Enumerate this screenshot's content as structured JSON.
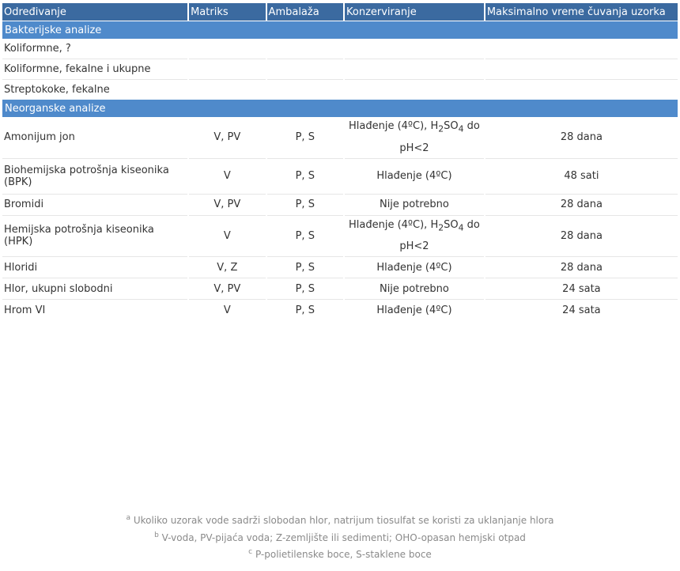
{
  "header": {
    "col1": "Određivanje",
    "col2": "Matriks",
    "col3": "Ambalaža",
    "col4": "Konzerviranje",
    "col5": "Maksimalno vreme čuvanja uzorka"
  },
  "sections": {
    "bacterial": "Bakterijske analize",
    "inorganic": "Neorganske analize"
  },
  "bacterial_rows": [
    {
      "name": "Koliformne, ?"
    },
    {
      "name": "Koliformne, fekalne i ukupne"
    },
    {
      "name": "Streptokoke, fekalne"
    }
  ],
  "inorganic_rows": [
    {
      "name": "Amonijum jon",
      "matrix": "V, PV",
      "packaging": "P, S",
      "conservation_a": "Hlađenje (4ºC), H",
      "conservation_sub1": "2",
      "conservation_b": "SO",
      "conservation_sub2": "4",
      "conservation_c": " do",
      "conservation_d": "pH<2",
      "time": "28 dana"
    },
    {
      "name": "Biohemijska potrošnja kiseonika (BPK)",
      "matrix": "V",
      "packaging": "P, S",
      "conservation": "Hlađenje (4ºC)",
      "time": "48 sati"
    },
    {
      "name": "Bromidi",
      "matrix": "V, PV",
      "packaging": "P, S",
      "conservation": "Nije potrebno",
      "time": "28 dana"
    },
    {
      "name": "Hemijska potrošnja kiseonika (HPK)",
      "matrix": "V",
      "packaging": "P, S",
      "conservation_a": "Hlađenje (4ºC), H",
      "conservation_sub1": "2",
      "conservation_b": "SO",
      "conservation_sub2": "4",
      "conservation_c": " do",
      "conservation_d": "pH<2",
      "time": "28 dana"
    },
    {
      "name": "Hloridi",
      "matrix": "V, Z",
      "packaging": "P, S",
      "conservation": "Hlađenje (4ºC)",
      "time": "28 dana"
    },
    {
      "name": "Hlor, ukupni slobodni",
      "matrix": "V, PV",
      "packaging": "P, S",
      "conservation": "Nije potrebno",
      "time": "24 sata"
    },
    {
      "name": "Hrom VI",
      "matrix": "V",
      "packaging": "P, S",
      "conservation": "Hlađenje (4ºC)",
      "time": "24 sata"
    }
  ],
  "footnotes": [
    {
      "mark": "a",
      "text": "Ukoliko uzorak vode sadrži slobodan hlor, natrijum tiosulfat se koristi za uklanjanje hlora"
    },
    {
      "mark": "b",
      "text": "V-voda, PV-pijaća voda; Z-zemljište ili sedimenti; OHO-opasan hemjski otpad"
    },
    {
      "mark": "c",
      "text": "P-polietilenske boce, S-staklene boce"
    }
  ],
  "colors": {
    "header_bg": "#3b6aa0",
    "section_bg": "#4f8acb",
    "text": "#333333",
    "footnote_text": "#8a8a8a"
  }
}
